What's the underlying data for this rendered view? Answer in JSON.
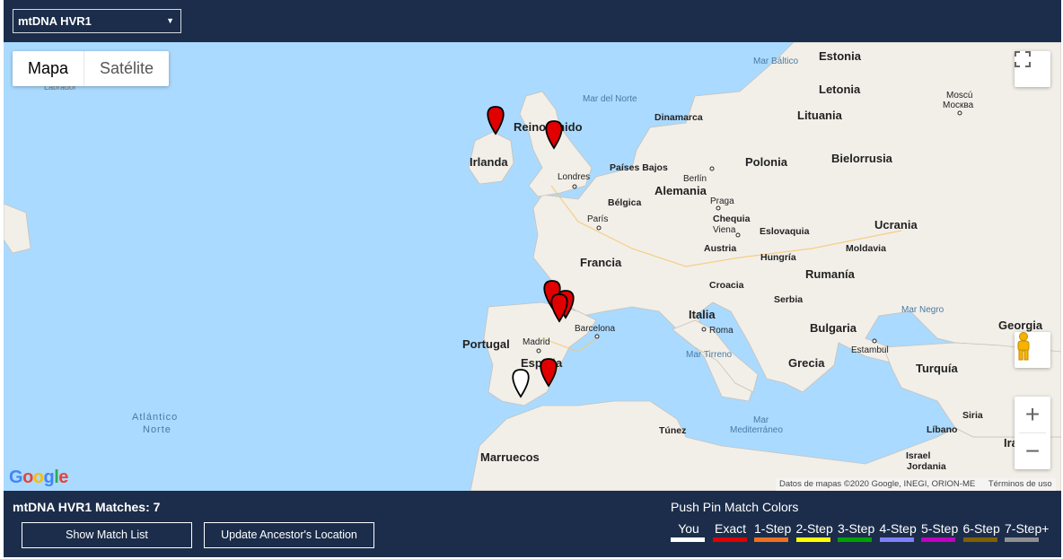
{
  "topbar": {
    "select_value": "mtDNA HVR1"
  },
  "map": {
    "type_controls": {
      "map": "Mapa",
      "satellite": "Satélite"
    },
    "attribution": "Datos de mapas ©2020 Google, INEGI, ORION-ME",
    "terms": "Términos de uso",
    "logo": "Google",
    "labels": {
      "mar_baltico": "Mar Báltico",
      "estonia": "Estonia",
      "letonia": "Letonia",
      "lituania": "Lituania",
      "mar_del_norte": "Mar del Norte",
      "dinamarca": "Dinamarca",
      "moscu": "Moscú",
      "moscu_ru": "Москва",
      "labrador": "Labrador",
      "reino_unido": "Reino Unido",
      "irlanda": "Irlanda",
      "paises_bajos": "Países Bajos",
      "berlin": "Berlín",
      "polonia": "Polonia",
      "bielorrusia": "Bielorrusia",
      "londres": "Londres",
      "alemania": "Alemania",
      "belgica": "Bélgica",
      "praga": "Praga",
      "paris": "París",
      "chequia": "Chequia",
      "viena": "Viena",
      "eslovaquia": "Eslovaquia",
      "ucrania": "Ucrania",
      "austria": "Austria",
      "moldavia": "Moldavia",
      "francia": "Francia",
      "hungria": "Hungría",
      "rumania": "Rumanía",
      "croacia": "Croacia",
      "serbia": "Serbia",
      "mar_negro": "Mar Negro",
      "georgia": "Georgia",
      "italia": "Italia",
      "portugal": "Portugal",
      "madrid": "Madrid",
      "barcelona": "Barcelona",
      "roma": "Roma",
      "bulgaria": "Bulgaria",
      "espana": "España",
      "mar_tirreno": "Mar Tirreno",
      "estambul": "Estambul",
      "grecia": "Grecia",
      "turquia": "Turquía",
      "atlantico": "Atlántico",
      "norte": "Norte",
      "siria": "Siria",
      "mar": "Mar",
      "mediterraneo": "Mediterráneo",
      "tunez": "Túnez",
      "libano": "Líbano",
      "iraq_partial": "Ira",
      "marruecos": "Marruecos",
      "israel": "Israel",
      "jordania": "Jordania"
    },
    "pins": [
      {
        "name": "pin-ireland",
        "color": "#e00000"
      },
      {
        "name": "pin-uk",
        "color": "#e00000"
      },
      {
        "name": "pin-north-spain-1",
        "color": "#e00000"
      },
      {
        "name": "pin-north-spain-2",
        "color": "#e00000"
      },
      {
        "name": "pin-north-spain-3",
        "color": "#e00000"
      },
      {
        "name": "pin-south-spain",
        "color": "#e00000"
      },
      {
        "name": "pin-ancestor",
        "color": "#ffffff"
      }
    ]
  },
  "bottom": {
    "matches_label": "mtDNA HVR1 Matches: 7",
    "show_list": "Show Match List",
    "update_location": "Update Ancestor's Location",
    "legend_title": "Push Pin Match Colors",
    "legend": [
      {
        "label": "You",
        "color": "#ffffff"
      },
      {
        "label": "Exact",
        "color": "#e00000"
      },
      {
        "label": "1-Step",
        "color": "#f07020"
      },
      {
        "label": "2-Step",
        "color": "#ffff00"
      },
      {
        "label": "3-Step",
        "color": "#00a000"
      },
      {
        "label": "4-Step",
        "color": "#8080ff"
      },
      {
        "label": "5-Step",
        "color": "#c000c0"
      },
      {
        "label": "6-Step",
        "color": "#806000"
      },
      {
        "label": "7-Step+",
        "color": "#909090"
      }
    ]
  }
}
